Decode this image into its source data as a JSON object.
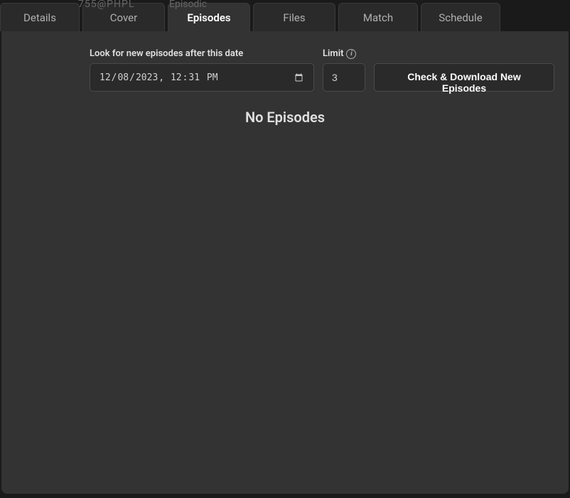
{
  "breadcrumb": {
    "hint1": "755@PHPL",
    "hint2": "Episodic"
  },
  "tabs": [
    {
      "label": "Details",
      "active": false
    },
    {
      "label": "Cover",
      "active": false
    },
    {
      "label": "Episodes",
      "active": true
    },
    {
      "label": "Files",
      "active": false
    },
    {
      "label": "Match",
      "active": false
    },
    {
      "label": "Schedule",
      "active": false
    }
  ],
  "form": {
    "date_label": "Look for new episodes after this date",
    "date_value": "2023-12-08T12:31",
    "limit_label": "Limit",
    "limit_value": "3",
    "check_button_label": "Check & Download New Episodes"
  },
  "main": {
    "no_episodes_text": "No Episodes"
  }
}
